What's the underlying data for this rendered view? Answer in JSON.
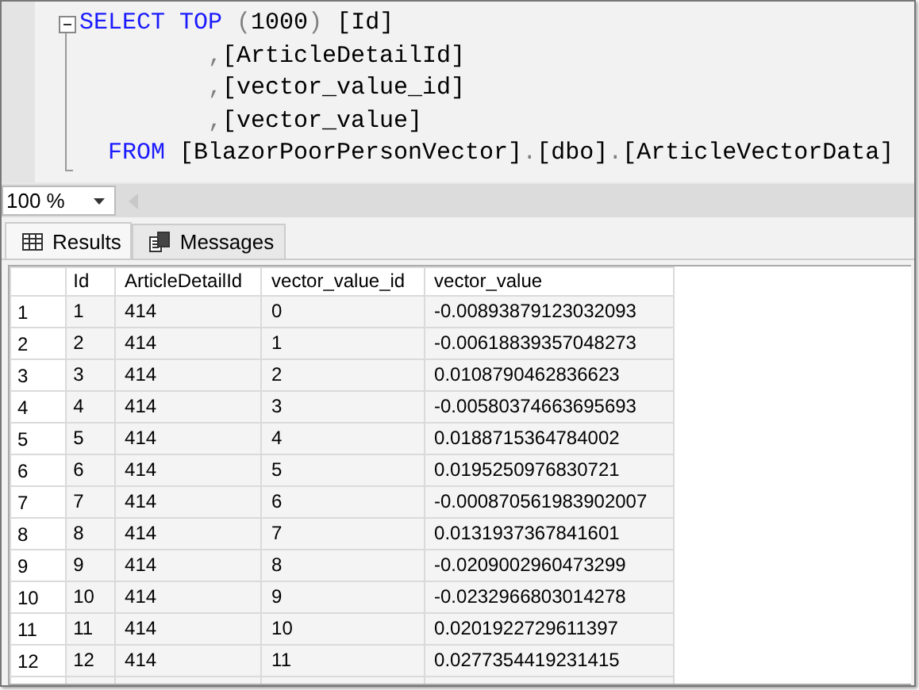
{
  "editor": {
    "lines": [
      {
        "kind": "select",
        "tokens": [
          {
            "text": "SELECT",
            "kind": "keyword"
          },
          {
            "text": " TOP",
            "kind": "keyword"
          },
          {
            "text": " (",
            "kind": "punct"
          },
          {
            "text": "1000",
            "kind": "plain"
          },
          {
            "text": ")",
            "kind": "punct"
          },
          {
            "text": " [Id]",
            "kind": "plain"
          }
        ]
      },
      {
        "kind": "column",
        "tokens": [
          {
            "text": ",",
            "kind": "punct"
          },
          {
            "text": "[ArticleDetailId]",
            "kind": "plain"
          }
        ]
      },
      {
        "kind": "column",
        "tokens": [
          {
            "text": ",",
            "kind": "punct"
          },
          {
            "text": "[vector_value_id]",
            "kind": "plain"
          }
        ]
      },
      {
        "kind": "column",
        "tokens": [
          {
            "text": ",",
            "kind": "punct"
          },
          {
            "text": "[vector_value]",
            "kind": "plain"
          }
        ]
      },
      {
        "kind": "from",
        "tokens": [
          {
            "text": "FROM",
            "kind": "keyword"
          },
          {
            "text": " [BlazorPoorPersonVector]",
            "kind": "plain"
          },
          {
            "text": ".",
            "kind": "punct"
          },
          {
            "text": "[dbo]",
            "kind": "plain"
          },
          {
            "text": ".",
            "kind": "punct"
          },
          {
            "text": "[ArticleVectorData]",
            "kind": "plain"
          }
        ]
      }
    ]
  },
  "zoom": {
    "value": "100 %"
  },
  "tabs": [
    {
      "label": "Results",
      "selected": true
    },
    {
      "label": "Messages",
      "selected": false
    }
  ],
  "grid": {
    "columns": [
      "Id",
      "ArticleDetailId",
      "vector_value_id",
      "vector_value"
    ],
    "rows": [
      {
        "number": "1",
        "cells": [
          "1",
          "414",
          "0",
          "-0.00893879123032093"
        ]
      },
      {
        "number": "2",
        "cells": [
          "2",
          "414",
          "1",
          "-0.00618839357048273"
        ]
      },
      {
        "number": "3",
        "cells": [
          "3",
          "414",
          "2",
          "0.0108790462836623"
        ]
      },
      {
        "number": "4",
        "cells": [
          "4",
          "414",
          "3",
          "-0.00580374663695693"
        ]
      },
      {
        "number": "5",
        "cells": [
          "5",
          "414",
          "4",
          "0.0188715364784002"
        ]
      },
      {
        "number": "6",
        "cells": [
          "6",
          "414",
          "5",
          "0.0195250976830721"
        ]
      },
      {
        "number": "7",
        "cells": [
          "7",
          "414",
          "6",
          "-0.000870561983902007"
        ]
      },
      {
        "number": "8",
        "cells": [
          "8",
          "414",
          "7",
          "0.0131937367841601"
        ]
      },
      {
        "number": "9",
        "cells": [
          "9",
          "414",
          "8",
          "-0.0209002960473299"
        ]
      },
      {
        "number": "10",
        "cells": [
          "10",
          "414",
          "9",
          "-0.0232966803014278"
        ]
      },
      {
        "number": "11",
        "cells": [
          "11",
          "414",
          "10",
          "0.0201922729611397"
        ]
      },
      {
        "number": "12",
        "cells": [
          "12",
          "414",
          "11",
          "0.0277354419231415"
        ]
      }
    ]
  }
}
